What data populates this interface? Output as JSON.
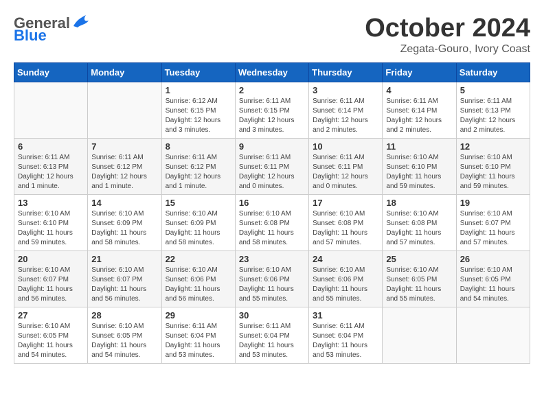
{
  "header": {
    "logo": {
      "general": "General",
      "blue": "Blue"
    },
    "title": "October 2024",
    "location": "Zegata-Gouro, Ivory Coast"
  },
  "weekdays": [
    "Sunday",
    "Monday",
    "Tuesday",
    "Wednesday",
    "Thursday",
    "Friday",
    "Saturday"
  ],
  "weeks": [
    [
      {
        "day": "",
        "info": ""
      },
      {
        "day": "",
        "info": ""
      },
      {
        "day": "1",
        "info": "Sunrise: 6:12 AM\nSunset: 6:15 PM\nDaylight: 12 hours and 3 minutes."
      },
      {
        "day": "2",
        "info": "Sunrise: 6:11 AM\nSunset: 6:15 PM\nDaylight: 12 hours and 3 minutes."
      },
      {
        "day": "3",
        "info": "Sunrise: 6:11 AM\nSunset: 6:14 PM\nDaylight: 12 hours and 2 minutes."
      },
      {
        "day": "4",
        "info": "Sunrise: 6:11 AM\nSunset: 6:14 PM\nDaylight: 12 hours and 2 minutes."
      },
      {
        "day": "5",
        "info": "Sunrise: 6:11 AM\nSunset: 6:13 PM\nDaylight: 12 hours and 2 minutes."
      }
    ],
    [
      {
        "day": "6",
        "info": "Sunrise: 6:11 AM\nSunset: 6:13 PM\nDaylight: 12 hours and 1 minute."
      },
      {
        "day": "7",
        "info": "Sunrise: 6:11 AM\nSunset: 6:12 PM\nDaylight: 12 hours and 1 minute."
      },
      {
        "day": "8",
        "info": "Sunrise: 6:11 AM\nSunset: 6:12 PM\nDaylight: 12 hours and 1 minute."
      },
      {
        "day": "9",
        "info": "Sunrise: 6:11 AM\nSunset: 6:11 PM\nDaylight: 12 hours and 0 minutes."
      },
      {
        "day": "10",
        "info": "Sunrise: 6:11 AM\nSunset: 6:11 PM\nDaylight: 12 hours and 0 minutes."
      },
      {
        "day": "11",
        "info": "Sunrise: 6:10 AM\nSunset: 6:10 PM\nDaylight: 11 hours and 59 minutes."
      },
      {
        "day": "12",
        "info": "Sunrise: 6:10 AM\nSunset: 6:10 PM\nDaylight: 11 hours and 59 minutes."
      }
    ],
    [
      {
        "day": "13",
        "info": "Sunrise: 6:10 AM\nSunset: 6:10 PM\nDaylight: 11 hours and 59 minutes."
      },
      {
        "day": "14",
        "info": "Sunrise: 6:10 AM\nSunset: 6:09 PM\nDaylight: 11 hours and 58 minutes."
      },
      {
        "day": "15",
        "info": "Sunrise: 6:10 AM\nSunset: 6:09 PM\nDaylight: 11 hours and 58 minutes."
      },
      {
        "day": "16",
        "info": "Sunrise: 6:10 AM\nSunset: 6:08 PM\nDaylight: 11 hours and 58 minutes."
      },
      {
        "day": "17",
        "info": "Sunrise: 6:10 AM\nSunset: 6:08 PM\nDaylight: 11 hours and 57 minutes."
      },
      {
        "day": "18",
        "info": "Sunrise: 6:10 AM\nSunset: 6:08 PM\nDaylight: 11 hours and 57 minutes."
      },
      {
        "day": "19",
        "info": "Sunrise: 6:10 AM\nSunset: 6:07 PM\nDaylight: 11 hours and 57 minutes."
      }
    ],
    [
      {
        "day": "20",
        "info": "Sunrise: 6:10 AM\nSunset: 6:07 PM\nDaylight: 11 hours and 56 minutes."
      },
      {
        "day": "21",
        "info": "Sunrise: 6:10 AM\nSunset: 6:07 PM\nDaylight: 11 hours and 56 minutes."
      },
      {
        "day": "22",
        "info": "Sunrise: 6:10 AM\nSunset: 6:06 PM\nDaylight: 11 hours and 56 minutes."
      },
      {
        "day": "23",
        "info": "Sunrise: 6:10 AM\nSunset: 6:06 PM\nDaylight: 11 hours and 55 minutes."
      },
      {
        "day": "24",
        "info": "Sunrise: 6:10 AM\nSunset: 6:06 PM\nDaylight: 11 hours and 55 minutes."
      },
      {
        "day": "25",
        "info": "Sunrise: 6:10 AM\nSunset: 6:05 PM\nDaylight: 11 hours and 55 minutes."
      },
      {
        "day": "26",
        "info": "Sunrise: 6:10 AM\nSunset: 6:05 PM\nDaylight: 11 hours and 54 minutes."
      }
    ],
    [
      {
        "day": "27",
        "info": "Sunrise: 6:10 AM\nSunset: 6:05 PM\nDaylight: 11 hours and 54 minutes."
      },
      {
        "day": "28",
        "info": "Sunrise: 6:10 AM\nSunset: 6:05 PM\nDaylight: 11 hours and 54 minutes."
      },
      {
        "day": "29",
        "info": "Sunrise: 6:11 AM\nSunset: 6:04 PM\nDaylight: 11 hours and 53 minutes."
      },
      {
        "day": "30",
        "info": "Sunrise: 6:11 AM\nSunset: 6:04 PM\nDaylight: 11 hours and 53 minutes."
      },
      {
        "day": "31",
        "info": "Sunrise: 6:11 AM\nSunset: 6:04 PM\nDaylight: 11 hours and 53 minutes."
      },
      {
        "day": "",
        "info": ""
      },
      {
        "day": "",
        "info": ""
      }
    ]
  ]
}
